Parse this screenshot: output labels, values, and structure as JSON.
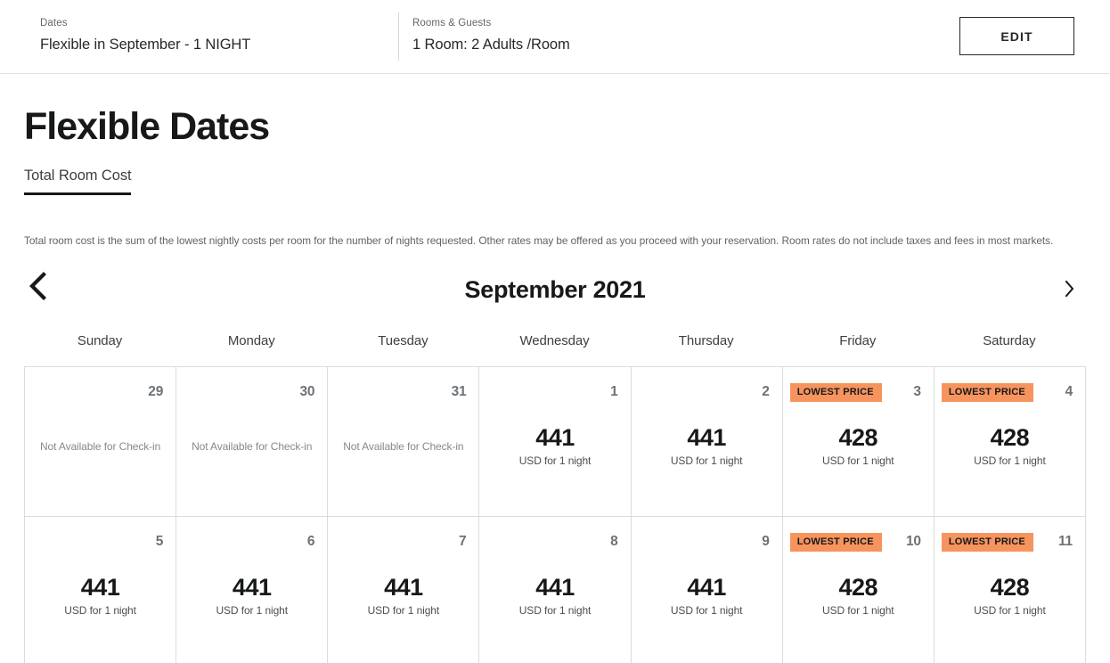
{
  "summary": {
    "dates": {
      "label": "Dates",
      "value": "Flexible in September - 1 NIGHT"
    },
    "rooms": {
      "label": "Rooms & Guests",
      "value": "1 Room: 2 Adults /Room"
    },
    "edit_label": "EDIT"
  },
  "page": {
    "title": "Flexible Dates",
    "tab_label": "Total Room Cost",
    "disclaimer": "Total room cost is the sum of the lowest nightly costs per room for the number of nights requested. Other rates may be offered as you proceed with your reservation. Room rates do not include taxes and fees in most markets."
  },
  "calendar": {
    "month_title": "September 2021",
    "prev_icon": "chevron-left-icon",
    "next_icon": "chevron-right-icon",
    "weekdays": [
      "Sunday",
      "Monday",
      "Tuesday",
      "Wednesday",
      "Thursday",
      "Friday",
      "Saturday"
    ],
    "badge_label": "LOWEST PRICE",
    "unavailable_label": "Not Available for Check-in",
    "price_note": "USD for 1 night",
    "accent_color": "#f7945d",
    "weeks": [
      [
        {
          "day": "29",
          "available": false,
          "price": null,
          "lowest": false
        },
        {
          "day": "30",
          "available": false,
          "price": null,
          "lowest": false
        },
        {
          "day": "31",
          "available": false,
          "price": null,
          "lowest": false
        },
        {
          "day": "1",
          "available": true,
          "price": "441",
          "lowest": false
        },
        {
          "day": "2",
          "available": true,
          "price": "441",
          "lowest": false
        },
        {
          "day": "3",
          "available": true,
          "price": "428",
          "lowest": true
        },
        {
          "day": "4",
          "available": true,
          "price": "428",
          "lowest": true
        }
      ],
      [
        {
          "day": "5",
          "available": true,
          "price": "441",
          "lowest": false
        },
        {
          "day": "6",
          "available": true,
          "price": "441",
          "lowest": false
        },
        {
          "day": "7",
          "available": true,
          "price": "441",
          "lowest": false
        },
        {
          "day": "8",
          "available": true,
          "price": "441",
          "lowest": false
        },
        {
          "day": "9",
          "available": true,
          "price": "441",
          "lowest": false
        },
        {
          "day": "10",
          "available": true,
          "price": "428",
          "lowest": true
        },
        {
          "day": "11",
          "available": true,
          "price": "428",
          "lowest": true
        }
      ]
    ]
  }
}
